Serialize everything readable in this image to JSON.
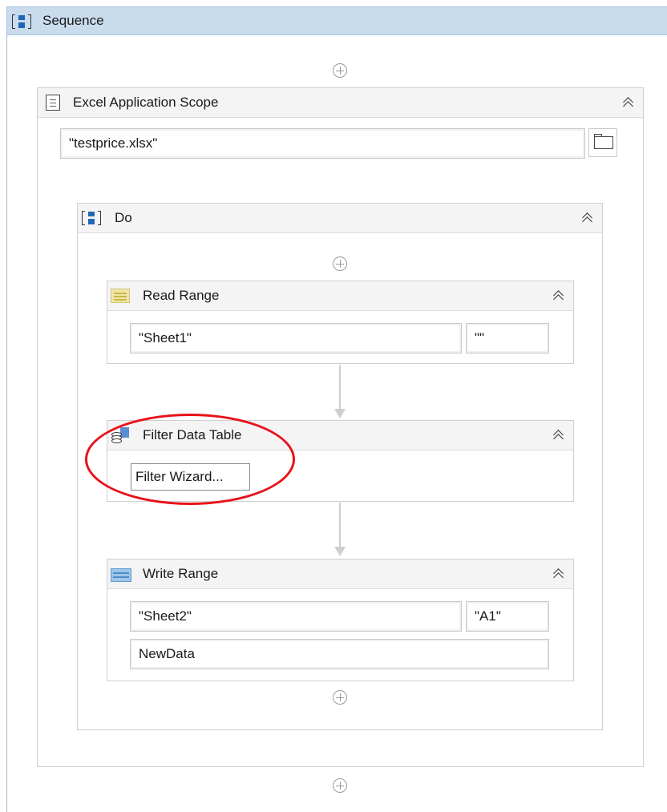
{
  "sequence": {
    "title": "Sequence"
  },
  "excel_scope": {
    "title": "Excel Application Scope",
    "workbook_path": "\"testprice.xlsx\""
  },
  "do_block": {
    "title": "Do"
  },
  "read_range": {
    "title": "Read Range",
    "sheet": "\"Sheet1\"",
    "range": "\"\""
  },
  "filter_table": {
    "title": "Filter Data Table",
    "wizard_label": "Filter Wizard..."
  },
  "write_range": {
    "title": "Write Range",
    "sheet": "\"Sheet2\"",
    "start_cell": "\"A1\"",
    "data_table": "NewData"
  },
  "colors": {
    "sequence_header": "#c9dcee",
    "annotation": "#e8121a",
    "icon_blue": "#1f67b5"
  },
  "icons": [
    "sequence-icon",
    "excel-scope-icon",
    "folder-icon",
    "read-range-icon",
    "filter-data-table-icon",
    "write-range-icon",
    "collapse-icon",
    "add-activity-icon"
  ]
}
